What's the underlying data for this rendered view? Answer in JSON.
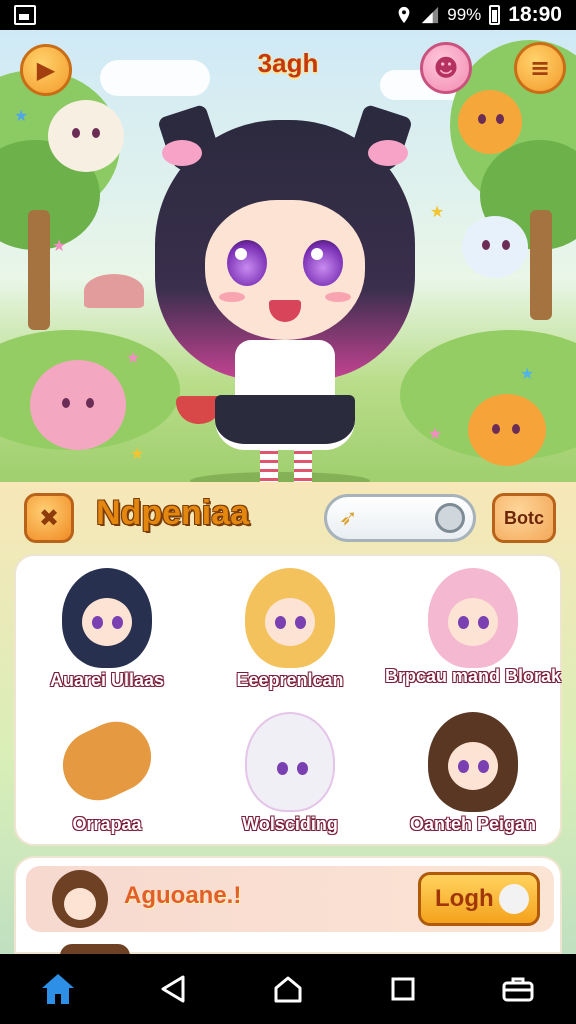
{
  "status_bar": {
    "battery": "99%",
    "time": "18:90"
  },
  "scene": {
    "title": "3agh"
  },
  "panel": {
    "title": "Ndpeniaa",
    "side_button": "Botc",
    "characters": [
      {
        "name": "Auarei Ullaas",
        "hair": "#27304f"
      },
      {
        "name": "Eeeprenlcan",
        "hair": "#f3c25c"
      },
      {
        "name": "Brpcau mand Blorak",
        "hair": "#f4b9d0"
      },
      {
        "name": "Orrapaa",
        "hair": "#e59a42"
      },
      {
        "name": "Wolsciding",
        "hair": "#f1eff6"
      },
      {
        "name": "Oanteh Peigan",
        "hair": "#5a3722"
      }
    ]
  },
  "login": {
    "message": "Aguoane.!",
    "button": "Logh"
  },
  "colors": {
    "accent": "#f39a2c",
    "title": "#e4870f",
    "pink": "#f28bb1"
  },
  "icons": [
    "home-icon",
    "back-icon",
    "home-outline-icon",
    "recents-icon",
    "toolbox-icon"
  ]
}
